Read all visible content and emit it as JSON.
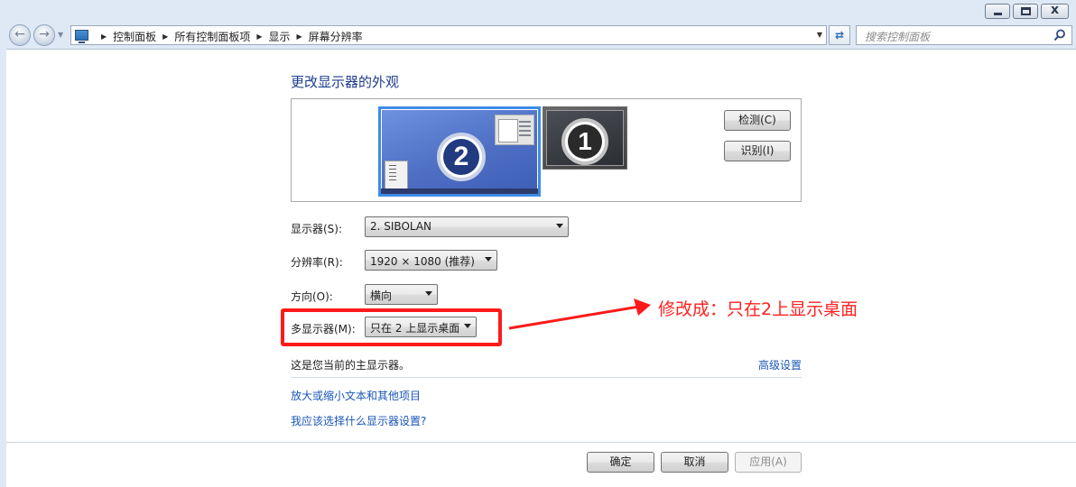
{
  "window": {
    "controls": {
      "close_label": "x"
    }
  },
  "address_bar": {
    "crumbs": [
      "控制面板",
      "所有控制面板项",
      "显示",
      "屏幕分辨率"
    ]
  },
  "search": {
    "placeholder": "搜索控制面板"
  },
  "page": {
    "title": "更改显示器的外观"
  },
  "monitors": {
    "primary_number": "2",
    "secondary_number": "1",
    "detect_label": "检测(C)",
    "identify_label": "识别(I)"
  },
  "form": {
    "display_label": "显示器(S):",
    "display_value": "2. SIBOLAN",
    "resolution_label": "分辨率(R):",
    "resolution_value": "1920 × 1080 (推荐)",
    "orientation_label": "方向(O):",
    "orientation_value": "横向",
    "multi_label": "多显示器(M):",
    "multi_value": "只在 2 上显示桌面"
  },
  "annotation": {
    "text": "修改成：只在2上显示桌面",
    "color": "#ff2020"
  },
  "info": {
    "main_note": "这是您当前的主显示器。",
    "advanced_link": "高级设置",
    "link_text_size": "放大或缩小文本和其他项目",
    "link_which_settings": "我应该选择什么显示器设置?"
  },
  "footer": {
    "ok_label": "确定",
    "cancel_label": "取消",
    "apply_label": "应用(A)"
  }
}
